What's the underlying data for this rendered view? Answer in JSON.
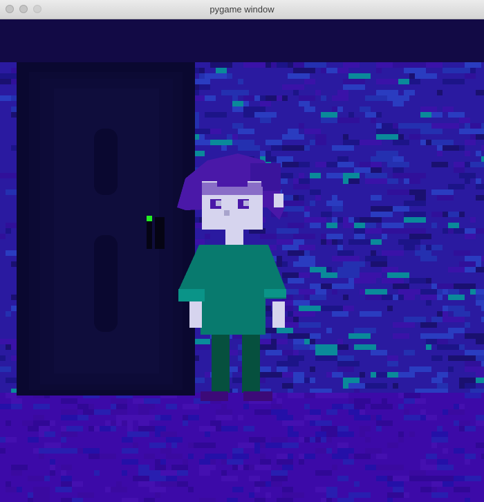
{
  "window": {
    "title": "pygame window"
  },
  "scene": {
    "objects": [
      "door",
      "door-handle",
      "character"
    ],
    "palette": {
      "sky_dark": "#120a45",
      "wall_purple": "#3a12a8",
      "wall_blue": "#2430b0",
      "teal_accent": "#0a8a9a",
      "floor": "#3c0aa8",
      "door_frame": "#0a0830",
      "door_panel": "#0f0d3c",
      "door_light": "#22ee22",
      "skin": "#d6d4ee",
      "hair": "#4a18a8",
      "shirt": "#087a6e",
      "pants": "#06503e",
      "shoes": "#3c0a78"
    }
  }
}
